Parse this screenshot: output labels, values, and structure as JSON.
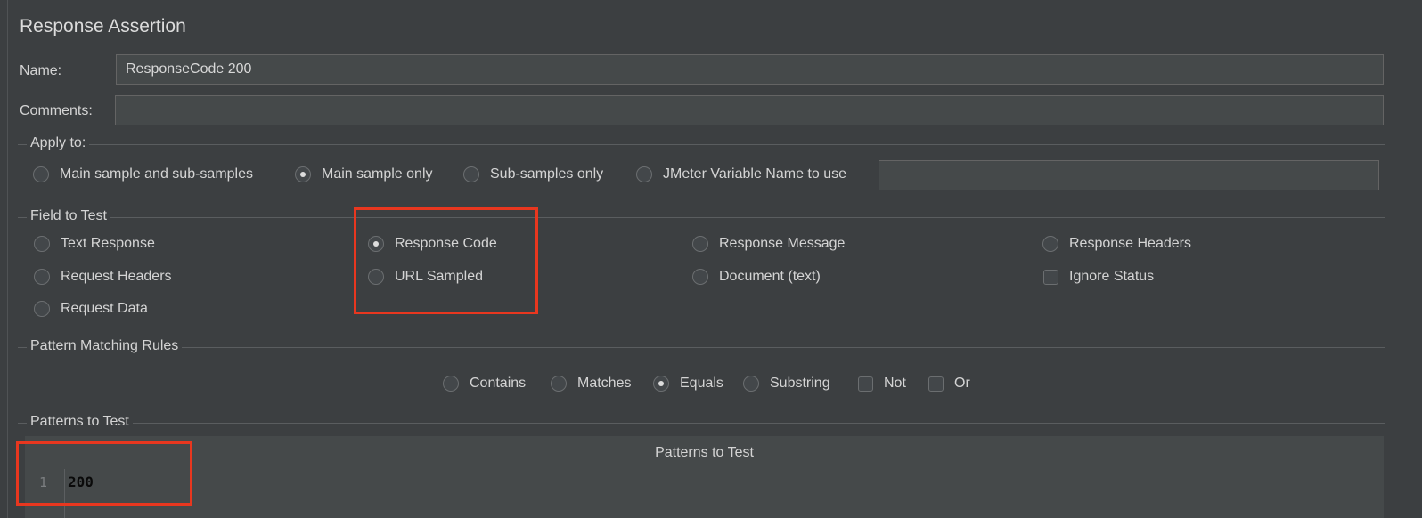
{
  "panel": {
    "title": "Response Assertion"
  },
  "name_field": {
    "label": "Name:",
    "value": "ResponseCode 200"
  },
  "comments_field": {
    "label": "Comments:",
    "value": ""
  },
  "apply_to": {
    "title": "Apply to:",
    "options": [
      {
        "label": "Main sample and sub-samples",
        "selected": false
      },
      {
        "label": "Main sample only",
        "selected": true
      },
      {
        "label": "Sub-samples only",
        "selected": false
      },
      {
        "label": "JMeter Variable Name to use",
        "selected": false
      }
    ],
    "variable_value": ""
  },
  "field_to_test": {
    "title": "Field to Test",
    "options": {
      "text_response": {
        "label": "Text Response",
        "selected": false
      },
      "request_headers": {
        "label": "Request Headers",
        "selected": false
      },
      "request_data": {
        "label": "Request Data",
        "selected": false
      },
      "response_code": {
        "label": "Response Code",
        "selected": true
      },
      "url_sampled": {
        "label": "URL Sampled",
        "selected": false
      },
      "response_message": {
        "label": "Response Message",
        "selected": false
      },
      "document_text": {
        "label": "Document (text)",
        "selected": false
      },
      "response_headers": {
        "label": "Response Headers",
        "selected": false
      }
    },
    "ignore_status": {
      "label": "Ignore Status",
      "checked": false
    }
  },
  "pattern_matching_rules": {
    "title": "Pattern Matching Rules",
    "options": [
      {
        "label": "Contains",
        "selected": false
      },
      {
        "label": "Matches",
        "selected": false
      },
      {
        "label": "Equals",
        "selected": true
      },
      {
        "label": "Substring",
        "selected": false
      }
    ],
    "not": {
      "label": "Not",
      "checked": false
    },
    "or": {
      "label": "Or",
      "checked": false
    }
  },
  "patterns_to_test": {
    "title": "Patterns to Test",
    "column_header": "Patterns to Test",
    "rows": [
      {
        "line": "1",
        "value": "200"
      }
    ]
  },
  "colors": {
    "background": "#3c3f41",
    "highlight": "#e8371f",
    "field": "#45494a"
  }
}
